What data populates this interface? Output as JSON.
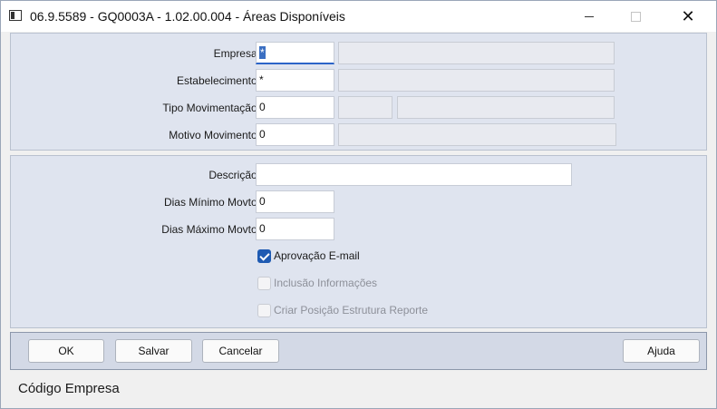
{
  "window": {
    "title": "06.9.5589 - GQ0003A - 1.02.00.004 - Áreas Disponíveis",
    "minimize_glyph": "",
    "close_glyph": "✕"
  },
  "top_panel": {
    "empresa": {
      "label": "Empresa:",
      "value": "*"
    },
    "estabelecimento": {
      "label": "Estabelecimento:",
      "value": "*"
    },
    "tipo_movimentacao": {
      "label": "Tipo Movimentação:",
      "value": "0"
    },
    "motivo_movimento": {
      "label": "Motivo Movimento:",
      "value": "0"
    }
  },
  "mid_panel": {
    "descricao": {
      "label": "Descrição:",
      "value": ""
    },
    "dias_minimo": {
      "label": "Dias Mínimo Movto:",
      "value": "0"
    },
    "dias_maximo": {
      "label": "Dias Máximo Movto:",
      "value": "0"
    },
    "checkboxes": [
      {
        "label": "Aprovação E-mail",
        "checked": true,
        "enabled": true
      },
      {
        "label": "Inclusão Informações",
        "checked": false,
        "enabled": false
      },
      {
        "label": "Criar Posição Estrutura Reporte",
        "checked": false,
        "enabled": false
      }
    ]
  },
  "buttons": {
    "ok": "OK",
    "salvar": "Salvar",
    "cancelar": "Cancelar",
    "ajuda": "Ajuda"
  },
  "status": {
    "text": "Código Empresa"
  },
  "colors": {
    "panel": "#dfe4ef",
    "accent": "#1e5ab2"
  }
}
